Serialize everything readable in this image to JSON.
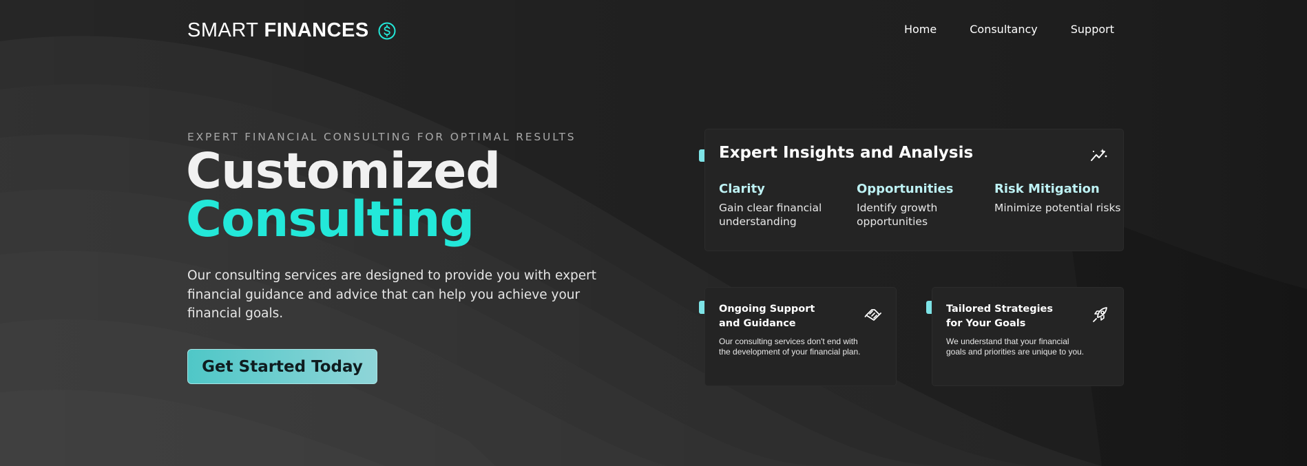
{
  "brand": {
    "word1": "SMART",
    "word2": "FINANCES",
    "accent": "#23e8d9"
  },
  "nav": {
    "items": [
      "Home",
      "Consultancy",
      "Support"
    ]
  },
  "hero": {
    "eyebrow": "EXPERT FINANCIAL CONSULTING FOR OPTIMAL RESULTS",
    "headline_line1": "Customized",
    "headline_line2": "Consulting",
    "lead": "Our consulting services are designed to provide you with expert financial guidance and advice that can help you achieve your financial goals.",
    "cta_label": "Get Started Today"
  },
  "insights": {
    "title": "Expert Insights and Analysis",
    "icon": "chart-sparkle-icon",
    "columns": [
      {
        "heading": "Clarity",
        "text": "Gain clear financial understanding"
      },
      {
        "heading": "Opportunities",
        "text": "Identify growth opportunities"
      },
      {
        "heading": "Risk Mitigation",
        "text": "Minimize potential risks"
      }
    ]
  },
  "features": [
    {
      "title_line1": "Ongoing Support",
      "title_line2": "and Guidance",
      "text": "Our consulting services don't end with the development of your financial plan.",
      "icon": "handshake-icon"
    },
    {
      "title_line1": "Tailored Strategies",
      "title_line2": "for Your Goals",
      "text": "We understand that your financial goals and priorities are unique to you.",
      "icon": "rocket-icon"
    }
  ]
}
